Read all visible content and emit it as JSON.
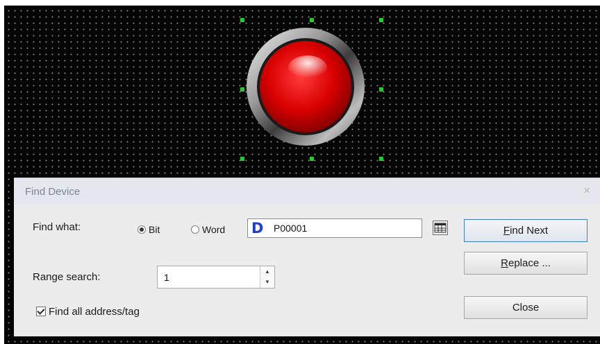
{
  "dialog": {
    "title": "Find Device",
    "close_glyph": "×",
    "find_what_label": "Find what:",
    "bit_label": "Bit",
    "word_label": "Word",
    "selected_mode": "Bit",
    "device_prefix": "D",
    "device_value": "P00001",
    "range_search_label": "Range search:",
    "range_value": "1",
    "find_all_label": "Find all address/tag",
    "find_all_checked": true,
    "buttons": {
      "find_next": {
        "mnemonic": "F",
        "rest": "ind Next"
      },
      "replace": {
        "mnemonic": "R",
        "rest": "eplace ..."
      },
      "close": "Close"
    }
  },
  "canvas": {
    "lamp_color": "#e00000",
    "handle_color": "#1fd11f",
    "icons": [
      "lamp-button-icon",
      "device-table-icon",
      "spin-up-icon",
      "spin-down-icon",
      "close-icon"
    ]
  }
}
